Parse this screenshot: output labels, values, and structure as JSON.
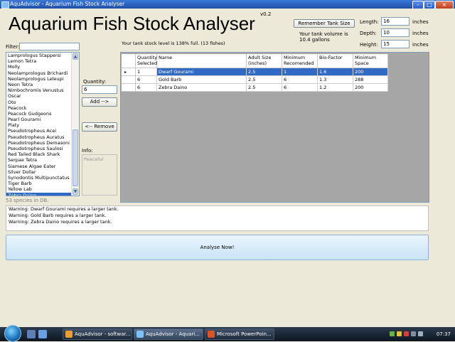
{
  "window": {
    "title": "AquAdvisor - Aquarium Fish Stock Analyser"
  },
  "header": {
    "app_title": "Aquarium Fish Stock Analyser",
    "version": "v0.2",
    "stock_level": "Your tank stock level is 138% full. (13 fishes)",
    "remember_button": "Remember Tank Size",
    "volume_line1": "Your tank volume is",
    "volume_line2": "10.4 gallons"
  },
  "tank": {
    "length_label": "Length:",
    "length_value": "16",
    "depth_label": "Depth:",
    "depth_value": "10",
    "height_label": "Height:",
    "height_value": "15",
    "unit": "inches"
  },
  "filter": {
    "label": "Filter:",
    "value": ""
  },
  "fish_list": {
    "items": [
      "Lamprologus Stappersi",
      "Lemon Tetra",
      "Molly",
      "Neolamprologus Brichardi",
      "Neolamprologus Leleupi",
      "Neon Tetra",
      "Nimbochromis Venustus",
      "Oscar",
      "Oto",
      "Peacock",
      "Peacock Gudgeons",
      "Pearl Gourami",
      "Platy",
      "Pseudotropheus Acei",
      "Pseudotropheus Auratus",
      "Pseudotropheus Demasoni",
      "Pseudotropheus Saulosi",
      "Red Tailed Black Shark",
      "Serpae Tetra",
      "Siamese Algae Eater",
      "Silver Dollar",
      "Synodontis Multipunctatus",
      "Tiger Barb",
      "Yellow Lab",
      "Zebra Daino"
    ],
    "selected_index": 24,
    "count_text": "53 species in DB."
  },
  "controls": {
    "quantity_label": "Quantity:",
    "quantity_value": "6",
    "add_button": "Add -->",
    "remove_button": "<-- Remove",
    "info_label": "Info:",
    "info_value": "Peaceful"
  },
  "grid": {
    "columns": [
      "Quantity Selected",
      "Name",
      "Adult Size (inches)",
      "Minimum Recomended",
      "Bio-Factor",
      "Minimum Space"
    ],
    "rows": [
      [
        "1",
        "Dwarf Gourami",
        "2.5",
        "1",
        "1.6",
        "200"
      ],
      [
        "6",
        "Gold Barb",
        "2.5",
        "6",
        "1.3",
        "288"
      ],
      [
        "6",
        "Zebra Daino",
        "2.5",
        "6",
        "1.2",
        "200"
      ]
    ],
    "selected_row": 0,
    "row_marker": "▸"
  },
  "warnings": [
    "Warning: Dwarf Gourami requires a larger tank.",
    "Warning: Gold Barb requires a larger tank.",
    "Warning: Zebra Daino requires a larger tank."
  ],
  "analyse_button": "Analyse Now!",
  "taskbar": {
    "buttons": [
      "AquAdvisor - softwar...",
      "AquAdvisor - Aquari...",
      "Microsoft PowerPoin..."
    ],
    "clock": "07:37"
  }
}
